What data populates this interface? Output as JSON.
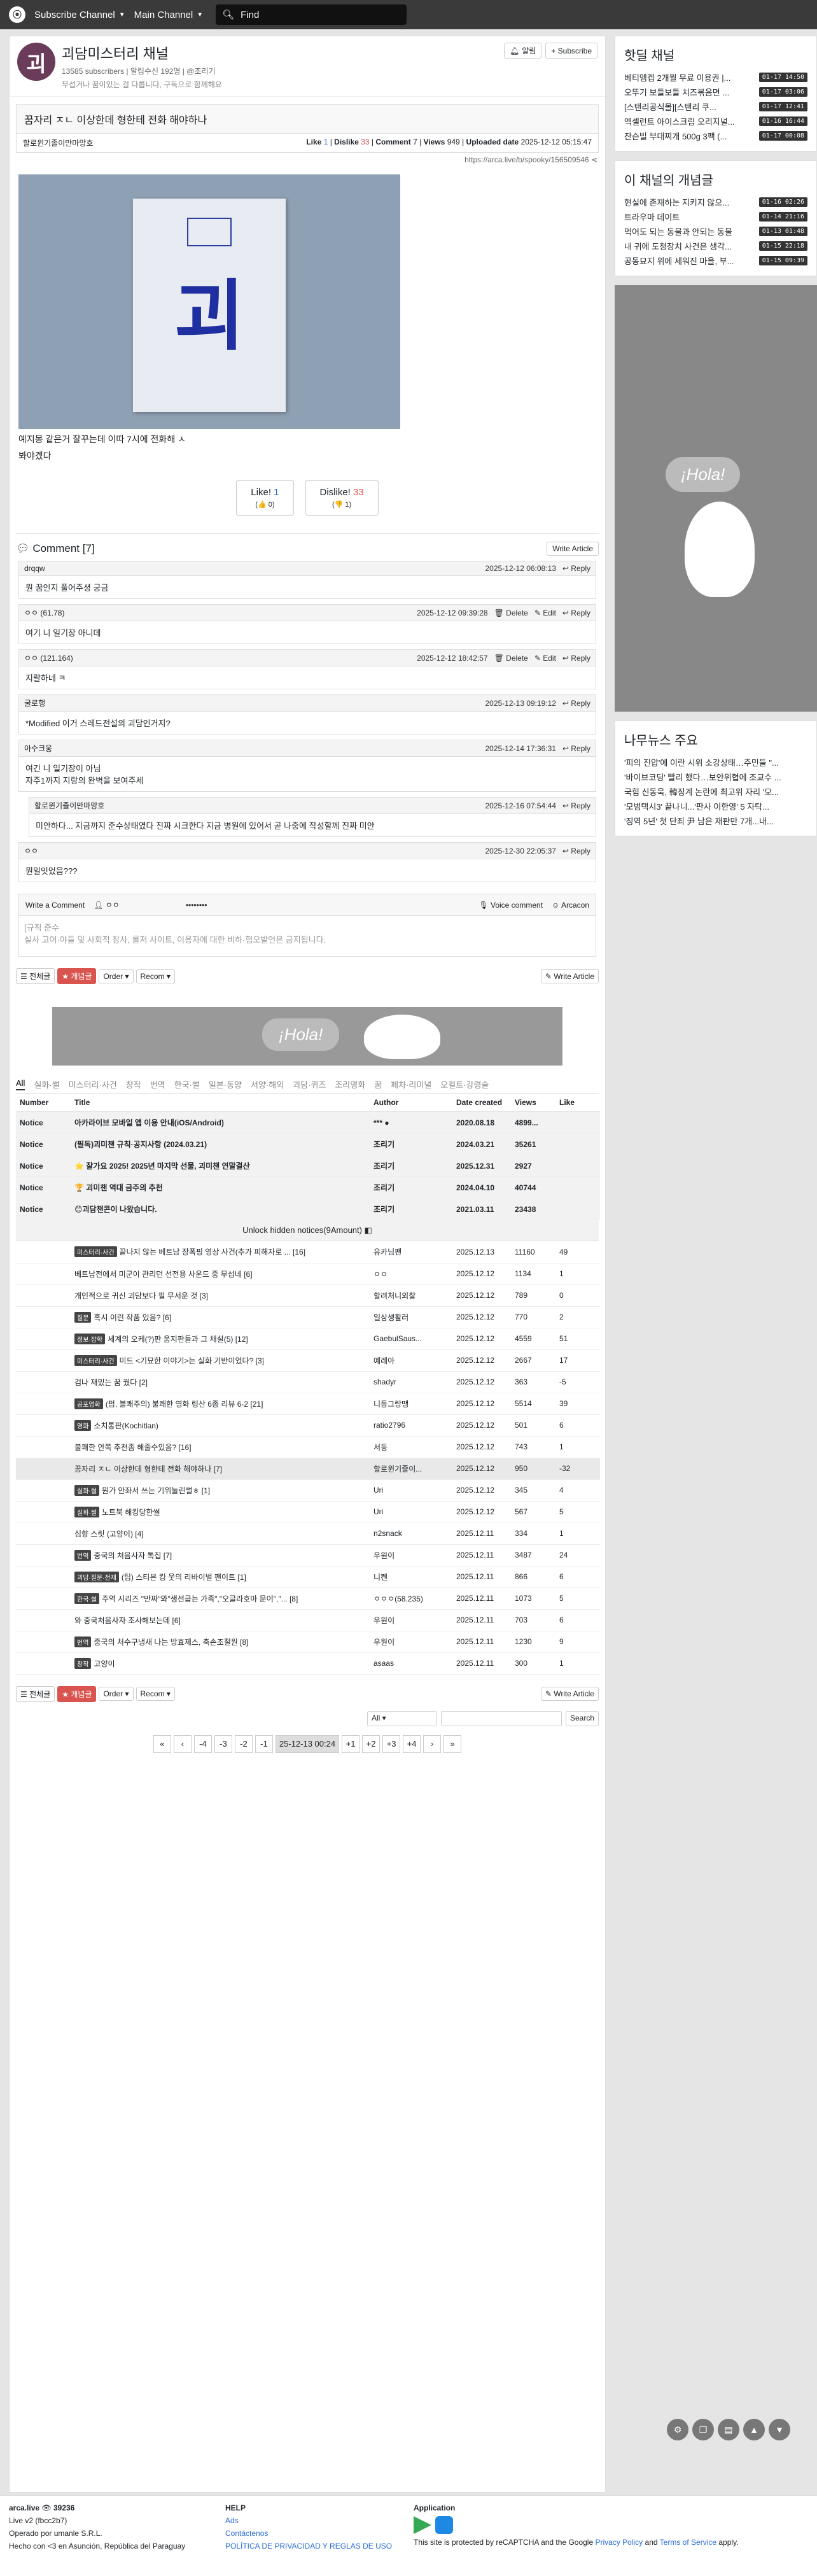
{
  "nav": {
    "subscribe": "Subscribe Channel",
    "main": "Main Channel",
    "search": "Find"
  },
  "channel": {
    "name": "괴담미스터리 채널",
    "subs": "13585 subscribers",
    "alert": "알림수신 192명",
    "owner": "@조리기",
    "desc": "무섭거나 꿈이있는 걸 다룹니다, 구독으로 함께해요",
    "alarm": "알림",
    "subscribe": "+ Subscribe"
  },
  "post": {
    "title": "꿈자리 ㅈㄴ 이상한데 형한테 전화 해야하나",
    "author": "할로윈기졸이만마망호",
    "like": "1",
    "dislike": "33",
    "comment": "7",
    "views": "949",
    "date": "2025-12-12 05:15:47",
    "link": "https://arca.live/b/spooky/156509546",
    "text1": "예지몽 같은거 잘꾸는데 이따 7시에 전화해 ㅅ",
    "text2": "봐야겠다",
    "like_btn": "Like!",
    "like_n": "1",
    "like_sub": "(👍 0)",
    "dis_btn": "Dislike!",
    "dis_n": "33",
    "dis_sub": "(👎 1)"
  },
  "comments": {
    "header": "Comment [7]",
    "write": "Write Article",
    "reply": "Reply",
    "delete": "Delete",
    "edit": "Edit",
    "list": [
      {
        "n": "drqqw",
        "d": "2025-12-12 06:08:13",
        "t": "뭔 꿈인지 풀어주셩 궁금",
        "owner": false
      },
      {
        "n": "ㅇㅇ (61.78)",
        "d": "2025-12-12 09:39:28",
        "t": "여기 니 일기장 아니데",
        "owner": true
      },
      {
        "n": "ㅇㅇ (121.164)",
        "d": "2025-12-12 18:42:57",
        "t": "지랄하네 ㅋ",
        "owner": true
      },
      {
        "n": "굴로행",
        "d": "2025-12-13 09:19:12",
        "t": "*Modified 이거 스레드전설의 괴담인거지?",
        "owner": false
      },
      {
        "n": "아수크웅",
        "d": "2025-12-14 17:36:31",
        "t": "여긴 니 일기장이 아님\n자주1까지 지랑의 완벽을 보여주세",
        "owner": false
      },
      {
        "n": "할로윈기졸이만마망호",
        "d": "2025-12-16 07:54:44",
        "t": "미안하다... 지금까지 준수상태였다 진짜 시크한다 지금 병원에 있어서 곧 나중에 작성할께 진짜 미안",
        "owner": false
      },
      {
        "n": "ㅇㅇ",
        "d": "2025-12-30 22:05:37",
        "t": "뭔일잇었음???",
        "owner": false
      }
    ]
  },
  "writer": {
    "label": "Write a Comment",
    "nick": "ㅇㅇ",
    "pw": "••••••••",
    "voice": "Voice comment",
    "arcacon": "Arcacon",
    "ph1": "[규칙 준수",
    "ph2": "실사 고어·야들 및 사회적 참사, 롤저 사이트, 이용자에 대한 비하·험오발언은 금지됩니다."
  },
  "toolbar": {
    "all": "전체글",
    "best": "개념글",
    "order": "Order",
    "recom": "Recom",
    "write": "Write Article"
  },
  "banner": {
    "txt": "¡Hola!"
  },
  "cats": [
    "All",
    "실화·썰",
    "미스터리·사건",
    "창작",
    "번역",
    "한국·썰",
    "일본·동양",
    "서양·해외",
    "괴담·퀴즈",
    "조리영화",
    "꿈",
    "폐차·리미널",
    "오컬트·강령술"
  ],
  "table": {
    "h": [
      "Number",
      "Title",
      "Author",
      "Date created",
      "Views",
      "Like"
    ],
    "notices": [
      [
        "Notice",
        "아카라이브 모바일 앱 이용 안내(iOS/Android)",
        "*** ●",
        "2020.08.18",
        "4899...",
        ""
      ],
      [
        "Notice",
        "(필독)괴미챈 규칙·공지사항 (2024.03.21)",
        "조리기",
        "2024.03.21",
        "35261",
        ""
      ],
      [
        "Notice",
        "⭐ 잘가요 2025! 2025년 마지막 선물, 괴미챈 연말결산",
        "조리기",
        "2025.12.31",
        "2927",
        ""
      ],
      [
        "Notice",
        "🏆 괴미챈 역대 금주의 추천",
        "조리기",
        "2024.04.10",
        "40744",
        ""
      ],
      [
        "Notice",
        "😊괴담챈콘이 나왔습니다.",
        "조리기",
        "2021.03.11",
        "23438",
        ""
      ]
    ],
    "unlock": "Unlock hidden notices(9Amount)",
    "rows": [
      [
        "",
        "미스터리·사건",
        "끝나지 않는 베트남 장폭핑 영상 사건(추가 피해자로 ... [16]",
        "유카님팬",
        "2025.12.13",
        "11160",
        "49"
      ],
      [
        "",
        "",
        "베트남전에서 미군이 관리던 선전용 사운드 중 무섭네 [6]",
        "ㅇㅇ",
        "2025.12.12",
        "1134",
        "1"
      ],
      [
        "",
        "",
        "개인적으로 귀신 괴담보다 필 무서운 것 [3]",
        "할려처니외찰",
        "2025.12.12",
        "789",
        "0"
      ],
      [
        "",
        "질문",
        "혹시 이런 작품 있음? [6]",
        "일상생활러",
        "2025.12.12",
        "770",
        "2"
      ],
      [
        "",
        "정보·잡학",
        "세계의 오케(?)판 움지판들과 그 채설(5) [12]",
        "GaebulSaus...",
        "2025.12.12",
        "4559",
        "51"
      ],
      [
        "",
        "미스터리·사건",
        "미드 <기묘한 이야기>는 실화 기반이었다? [3]",
        "예레아",
        "2025.12.12",
        "2667",
        "17"
      ],
      [
        "",
        "",
        "검나 재밌는 꿈 꿨다 [2]",
        "shadyr",
        "2025.12.12",
        "363",
        "-5"
      ],
      [
        "",
        "공포영화",
        "(펌, 블쾌주의) 불쾌한 영화 링산 6종 리뷰 6-2 [21]",
        "니동그랑땡",
        "2025.12.12",
        "5514",
        "39"
      ],
      [
        "",
        "영화",
        "소치통판(Kochitlan)",
        "ratio2796",
        "2025.12.12",
        "501",
        "6"
      ],
      [
        "",
        "",
        "불쾌한 안쪽 추천좀 해줄수있음? [16]",
        "서동",
        "2025.12.12",
        "743",
        "1"
      ],
      [
        "hl",
        "",
        "꿈자리 ㅈㄴ 이상한데 형한테 전화 해야하나 [7]",
        "할로윈기졸이...",
        "2025.12.12",
        "950",
        "-32"
      ],
      [
        "",
        "실화·썰",
        "뭔가 안좌서 쓰는 기위눌린썰ㅎ [1]",
        "Uri",
        "2025.12.12",
        "345",
        "4"
      ],
      [
        "",
        "실화·썰",
        "노트북 해킹당한썰",
        "Uri",
        "2025.12.12",
        "567",
        "5"
      ],
      [
        "",
        "",
        "심향 스릿 (고양이) [4]",
        "n2snack",
        "2025.12.11",
        "334",
        "1"
      ],
      [
        "",
        "번역",
        "중국의 처음사자 톡집 [7]",
        "우원이",
        "2025.12.11",
        "3487",
        "24"
      ],
      [
        "",
        "괴담·질문·전재",
        "(팁) 스티븐 킹 웃의 리바이벌 팬이트 [1]",
        "니켄",
        "2025.12.11",
        "866",
        "6"
      ],
      [
        "",
        "한국·썰",
        "주역 시리즈 \"만짜\"와\"생선굽는 가족\",\"오글라호마 문어\",\"... [8]",
        "ㅇㅇㅇ(58.235)",
        "2025.12.11",
        "1073",
        "5"
      ],
      [
        "",
        "",
        "와 중국처음사자 조사해보는데 [6]",
        "우원이",
        "2025.12.11",
        "703",
        "6"
      ],
      [
        "",
        "번역",
        "중국의 처수구냉새 나는 방효제스, 축손조절원 [8]",
        "우원이",
        "2025.12.11",
        "1230",
        "9"
      ],
      [
        "",
        "창작",
        "고양이",
        "asaas",
        "2025.12.11",
        "300",
        "1"
      ]
    ]
  },
  "pager": {
    "all": "All",
    "search": "Search",
    "pages": [
      "«",
      "‹",
      "-4",
      "-3",
      "-2",
      "-1",
      "25-12-13 00:24",
      "+1",
      "+2",
      "+3",
      "+4",
      "›",
      "»"
    ]
  },
  "side": {
    "hot": "핫딜 채널",
    "hot_items": [
      [
        "베티엠켑 2개월 무료 이용권 |...",
        "01-17 14:50"
      ],
      [
        "오뚜기 보들보들 치즈볶음면 ...",
        "01-17 03:06"
      ],
      [
        "[스탠리공식몰][스탠리 쿠...",
        "01-17 12:41"
      ],
      [
        "엑셀런트 아이스크림 오리지널...",
        "01-16 16:44"
      ],
      [
        "잔슨빌 부대찌개 500g 3팩 (...",
        "01-17 00:08"
      ]
    ],
    "best": "이 채널의 개념글",
    "best_items": [
      [
        "현실에 존재하는 지키지 않으...",
        "01-16 02:26"
      ],
      [
        "트라우마 데이트",
        "01-14 21:16"
      ],
      [
        "먹어도 되는 동물과 안되는 동물",
        "01-13 01:48"
      ],
      [
        "내 귀에 도청장치 사건은 생각...",
        "01-15 22:18"
      ],
      [
        "공동묘지 위에 세워진 마을, 부...",
        "01-15 09:39"
      ]
    ],
    "news": "나무뉴스 주요",
    "news_items": [
      "'피의 진압'에 이란 시위 소강상태…주민들 \"...",
      "'바이브코딩' 빨리 했다…보안위협에 조교수 ...",
      "국힘 신동욱, 韓징계 논란에 최고위 자리 '모...",
      "'모범택시3' 끝나니...'판사 이한영' 5 자탁...",
      "'징역 5년' 첫 단죄 尹 남은 재판만 7개...내..."
    ]
  },
  "footer": {
    "site": "arca.live",
    "count": "39236",
    "ver": "Live v2 (fbcc2b7)",
    "op": "Operado por umanle S.R.L.",
    "made": "Hecho con <3 en Asunción, República del Paraguay",
    "help": "HELP",
    "ads": "Ads",
    "contact": "Contáctenos",
    "policy": "POLÍTICA DE PRIVACIDAD Y REGLAS DE USO",
    "app": "Application",
    "recap1": "This site is protected by reCAPTCHA and the Google",
    "privacy": "Privacy Policy",
    "and": "and",
    "terms": "Terms of Service",
    "apply": "apply."
  }
}
